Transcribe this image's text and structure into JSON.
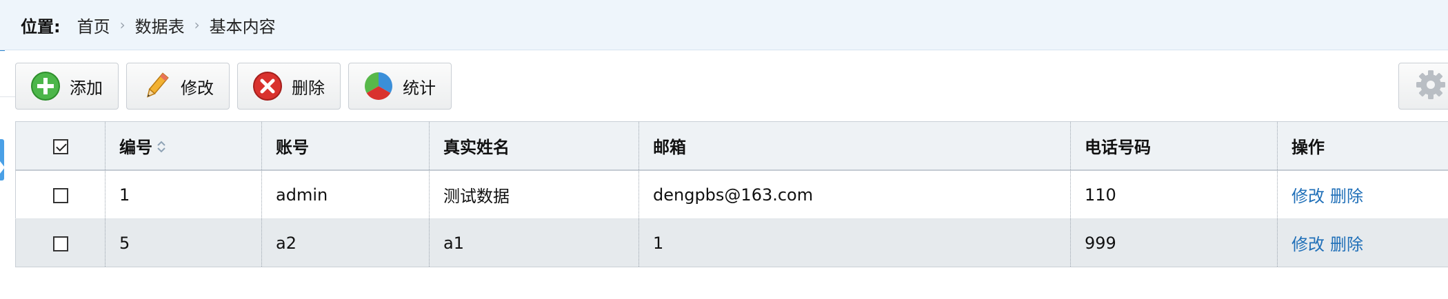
{
  "breadcrumb": {
    "label": "位置:",
    "items": [
      "首页",
      "数据表",
      "基本内容"
    ]
  },
  "toolbar": {
    "buttons": [
      {
        "label": "添加",
        "icon": "add-icon"
      },
      {
        "label": "修改",
        "icon": "pencil-icon"
      },
      {
        "label": "删除",
        "icon": "delete-icon"
      },
      {
        "label": "统计",
        "icon": "pie-chart-icon"
      }
    ],
    "settings_icon": "gear-icon"
  },
  "table": {
    "headers": [
      "编号",
      "账号",
      "真实姓名",
      "邮箱",
      "电话号码",
      "操作"
    ],
    "rows": [
      {
        "checked": false,
        "id": "1",
        "account": "admin",
        "name": "测试数据",
        "email": "dengpbs@163.com",
        "phone": "110",
        "edit": "修改",
        "delete": "删除"
      },
      {
        "checked": false,
        "id": "5",
        "account": "a2",
        "name": "a1",
        "email": "1",
        "phone": "999",
        "edit": "修改",
        "delete": "删除"
      }
    ]
  },
  "colors": {
    "accent": "#2a85cf",
    "link": "#1f6fb8",
    "header_bg": "#eef5fb",
    "alt_row": "#e6eaed"
  }
}
